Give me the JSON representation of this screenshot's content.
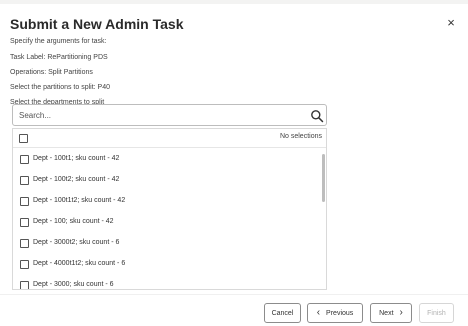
{
  "dialog": {
    "title": "Submit a New Admin Task",
    "close_symbol": "×"
  },
  "info": {
    "specify": "Specify the arguments for task:",
    "task_label": "Task Label: RePartitioning PDS",
    "operations": "Operations: Split Partitions",
    "partitions": "Select the partitions to split: P40",
    "departments": "Select the departments to split"
  },
  "search": {
    "placeholder": "Search..."
  },
  "list": {
    "selection_status": "No selections",
    "items": [
      {
        "label": "Dept - 100t1; sku count - 42"
      },
      {
        "label": "Dept - 100t2; sku count - 42"
      },
      {
        "label": "Dept - 100t1t2; sku count - 42"
      },
      {
        "label": "Dept - 100; sku count - 42"
      },
      {
        "label": "Dept - 3000t2; sku count - 6"
      },
      {
        "label": "Dept - 4000t1t2; sku count - 6"
      },
      {
        "label": "Dept - 3000; sku count - 6"
      }
    ]
  },
  "footer": {
    "cancel": "Cancel",
    "previous": "Previous",
    "next": "Next",
    "finish": "Finish",
    "prev_chevron": "‹",
    "next_chevron": "›"
  },
  "icons": {
    "search": "search-icon",
    "close": "close-icon",
    "checkbox": "checkbox-icon"
  }
}
